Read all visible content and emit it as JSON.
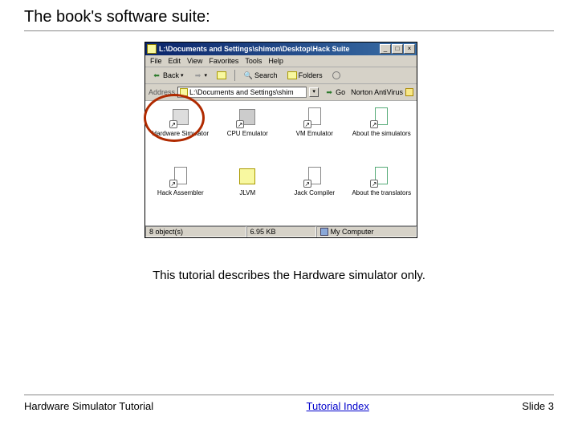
{
  "title": "The book's software suite:",
  "caption": "This tutorial describes the Hardware simulator only.",
  "footer": {
    "left": "Hardware Simulator Tutorial",
    "link": "Tutorial Index",
    "right": "Slide 3"
  },
  "window": {
    "title": "L:\\Documents and Settings\\shimon\\Desktop\\Hack Suite",
    "menu": [
      "File",
      "Edit",
      "View",
      "Favorites",
      "Tools",
      "Help"
    ],
    "toolbar": {
      "back": "Back",
      "search": "Search",
      "folders": "Folders"
    },
    "address": {
      "label": "Address",
      "path": "L:\\Documents and Settings\\shim",
      "go": "Go",
      "norton": "Norton AntiVirus"
    },
    "items": [
      {
        "label": "Hardware Simulator"
      },
      {
        "label": "CPU Emulator"
      },
      {
        "label": "VM Emulator"
      },
      {
        "label": "About the simulators"
      },
      {
        "label": "Hack Assembler"
      },
      {
        "label": "JLVM"
      },
      {
        "label": "Jack Compiler"
      },
      {
        "label": "About the translators"
      }
    ],
    "status": {
      "objects": "8 object(s)",
      "size": "6.95 KB",
      "location": "My Computer"
    },
    "winbuttons": {
      "min": "_",
      "max": "□",
      "close": "×"
    }
  }
}
